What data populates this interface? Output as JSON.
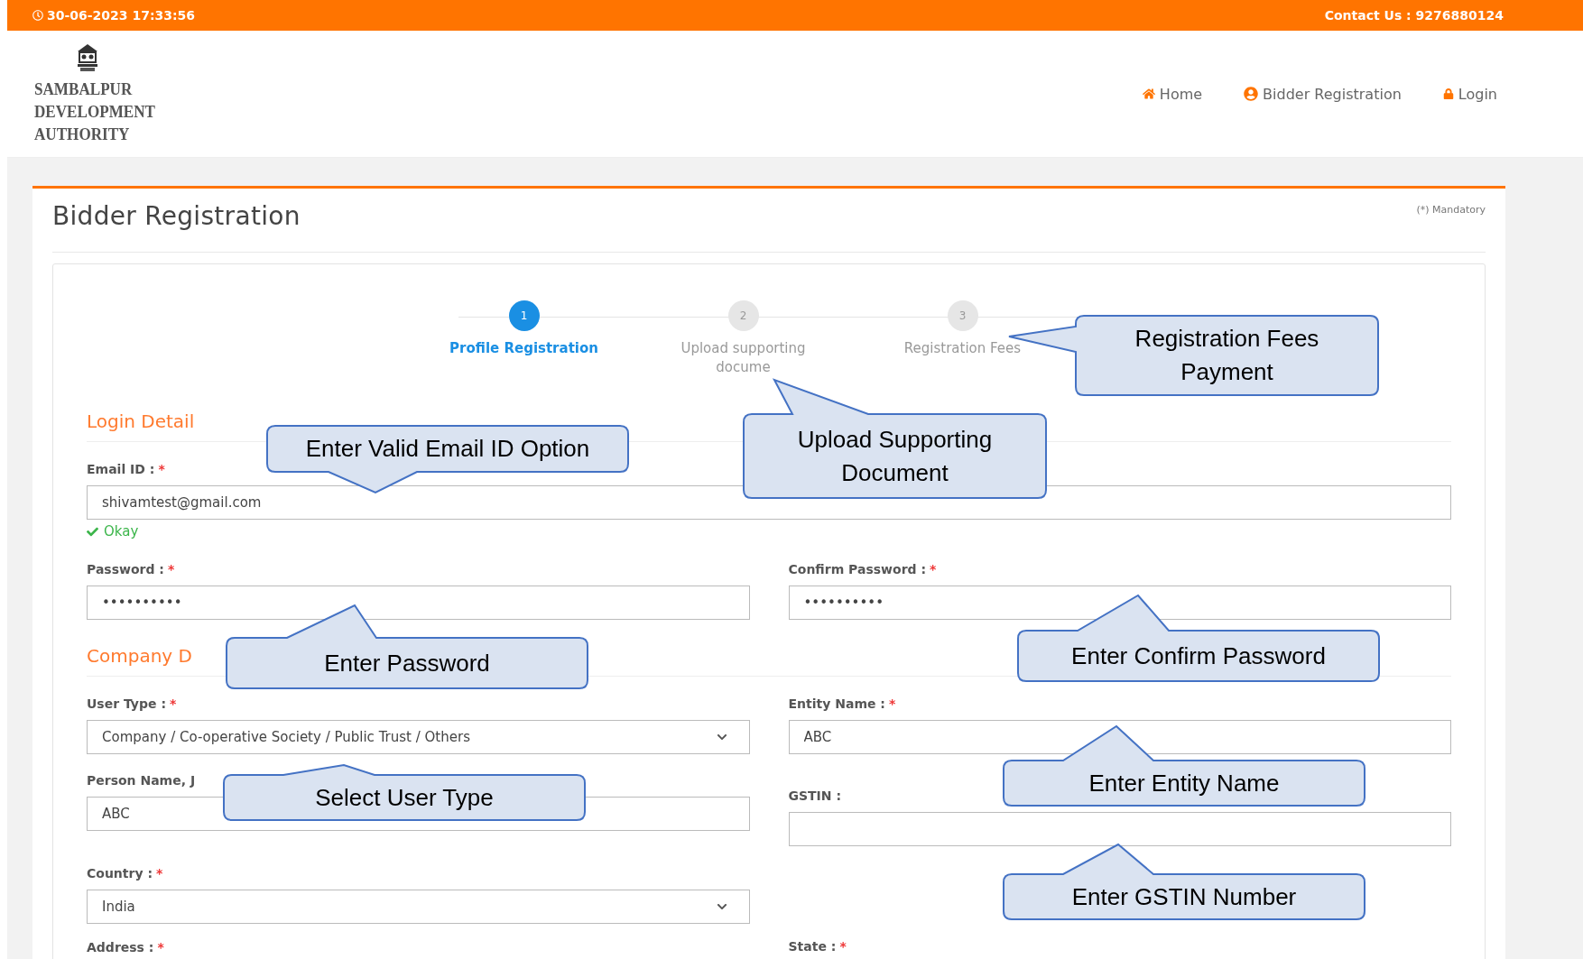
{
  "top_bar": {
    "datetime": "30-06-2023 17:33:56",
    "contact": "Contact Us : 9276880124"
  },
  "logo": {
    "lines": [
      "SAMBALPUR",
      "DEVELOPMENT",
      "AUTHORITY"
    ]
  },
  "nav": [
    {
      "label": "Home",
      "kind": "home"
    },
    {
      "label": "Bidder Registration",
      "kind": "user"
    },
    {
      "label": "Login",
      "kind": "lock"
    }
  ],
  "page": {
    "title": "Bidder Registration",
    "mandatory_note": "(*) Mandatory"
  },
  "steps": [
    {
      "number": "1",
      "label": "Profile Registration",
      "selected": true
    },
    {
      "number": "2",
      "label": "Upload supporting docume",
      "selected": false
    },
    {
      "number": "3",
      "label": "Registration Fees",
      "selected": false
    }
  ],
  "login_section": {
    "title": "Login Detail",
    "email": {
      "label": "Email ID :",
      "required_mark": "*",
      "kind": "text",
      "value": "shivamtest@gmail.com",
      "validation": "Okay"
    },
    "password": {
      "label": "Password :",
      "required_mark": "*",
      "kind": "text",
      "value": "••••••••••"
    },
    "confirm_password": {
      "label": "Confirm Password :",
      "required_mark": "*",
      "kind": "text",
      "value": "••••••••••"
    }
  },
  "company_section": {
    "title": "Company D",
    "left_fields": [
      {
        "label": "User Type :",
        "required_mark": "*",
        "kind": "select",
        "value": "Company / Co-operative Society / Public Trust / Others"
      },
      {
        "label": "Person Name, J",
        "kind": "text",
        "value": "ABC"
      },
      {
        "label": "Country :",
        "required_mark": "*",
        "kind": "select",
        "value": "India"
      },
      {
        "label": "Address :",
        "required_mark": "*",
        "kind": "label"
      }
    ],
    "right_fields": [
      {
        "label": "Entity Name :",
        "required_mark": "*",
        "kind": "text",
        "value": "ABC"
      },
      {
        "label": "GSTIN :",
        "kind": "text"
      },
      {
        "label": "State :",
        "required_mark": "*",
        "kind": "label"
      }
    ]
  },
  "callouts": [
    {
      "text": "Registration Fees Payment"
    },
    {
      "text": "Enter Valid Email ID Option"
    },
    {
      "text": "Upload Supporting Document"
    },
    {
      "text": "Enter Password"
    },
    {
      "text": "Enter Confirm Password"
    },
    {
      "text": "Select User Type"
    },
    {
      "text": "Enter Entity Name"
    },
    {
      "text": "Enter GSTIN Number"
    }
  ]
}
